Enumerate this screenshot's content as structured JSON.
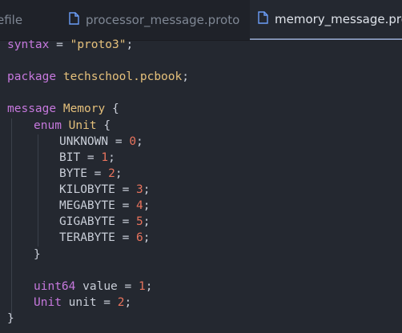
{
  "tabs": [
    {
      "label": "efile",
      "icon": "file-icon",
      "active": false
    },
    {
      "label": "processor_message.proto",
      "icon": "file-icon",
      "active": false
    },
    {
      "label": "memory_message.proto",
      "icon": "file-icon",
      "active": true
    }
  ],
  "code": {
    "syntax_kw": "syntax",
    "syntax_eq": " = ",
    "syntax_str": "\"proto3\"",
    "syntax_semi": ";",
    "package_kw": "package",
    "package_name": "techschool.pcbook",
    "package_semi": ";",
    "message_kw": "message",
    "message_name": "Memory",
    "open_brace": "{",
    "enum_kw": "enum",
    "enum_name": "Unit",
    "enum_values": [
      {
        "name": "UNKNOWN",
        "num": "0"
      },
      {
        "name": "BIT",
        "num": "1"
      },
      {
        "name": "BYTE",
        "num": "2"
      },
      {
        "name": "KILOBYTE",
        "num": "3"
      },
      {
        "name": "MEGABYTE",
        "num": "4"
      },
      {
        "name": "GIGABYTE",
        "num": "5"
      },
      {
        "name": "TERABYTE",
        "num": "6"
      }
    ],
    "close_brace": "}",
    "field1_type": "uint64",
    "field1_name": "value",
    "field1_num": "1",
    "field2_type": "Unit",
    "field2_name": "unit",
    "field2_num": "2",
    "eq": " = ",
    "semi": ";"
  }
}
